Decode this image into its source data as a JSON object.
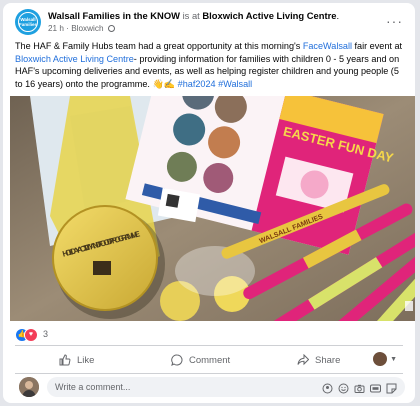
{
  "post": {
    "page_name": "Walsall Families in the KNOW",
    "connector": " is at ",
    "location": "Bloxwich Active Living Centre",
    "location_suffix": ".",
    "time": "21 h",
    "sep": " · ",
    "place": "Bloxwich",
    "avatar_text": "Walsall Families",
    "text_parts": {
      "p1": "The HAF & Family Hubs team had a great opportunity at this morning's ",
      "tag1": "FaceWalsall",
      "p2": " fair event at ",
      "tag2": "Bloxwich Active Living Centre",
      "p3": "- providing information for families with children 0 - 5 years and on HAF's upcoming deliveries and events, as well as helping register children and young people (5 to 16 years) onto the programme. 👋✍️ ",
      "hashtag1": "#haf2024",
      "hashtag2": "#Walsall"
    }
  },
  "photo": {
    "leaflet_title": "EASTER FUN DAY",
    "badge_text": "HOLIDAY ACTIVITY AND FOOD PROGRAMME",
    "pen_text": "WALSALL FAMILIES",
    "colors": {
      "table": "#8a7a66",
      "pink": "#e0247a",
      "yellow": "#e8c640",
      "lime": "#d8e26a"
    }
  },
  "reactions": {
    "count": "3",
    "types": [
      "like",
      "love"
    ]
  },
  "actions": {
    "like": "Like",
    "comment": "Comment",
    "share": "Share"
  },
  "comment": {
    "placeholder": "Write a comment..."
  },
  "colors": {
    "link": "#216fdb",
    "muted": "#65676b",
    "like_blue": "#1877f2",
    "love_red": "#f33e58"
  },
  "icons": [
    "more-options-icon",
    "globe-icon",
    "like-icon",
    "comment-icon",
    "share-icon",
    "avatar-icon",
    "gif-icon",
    "camera-icon",
    "emoji-icon",
    "sticker-icon",
    "avatar-sticker-icon"
  ]
}
